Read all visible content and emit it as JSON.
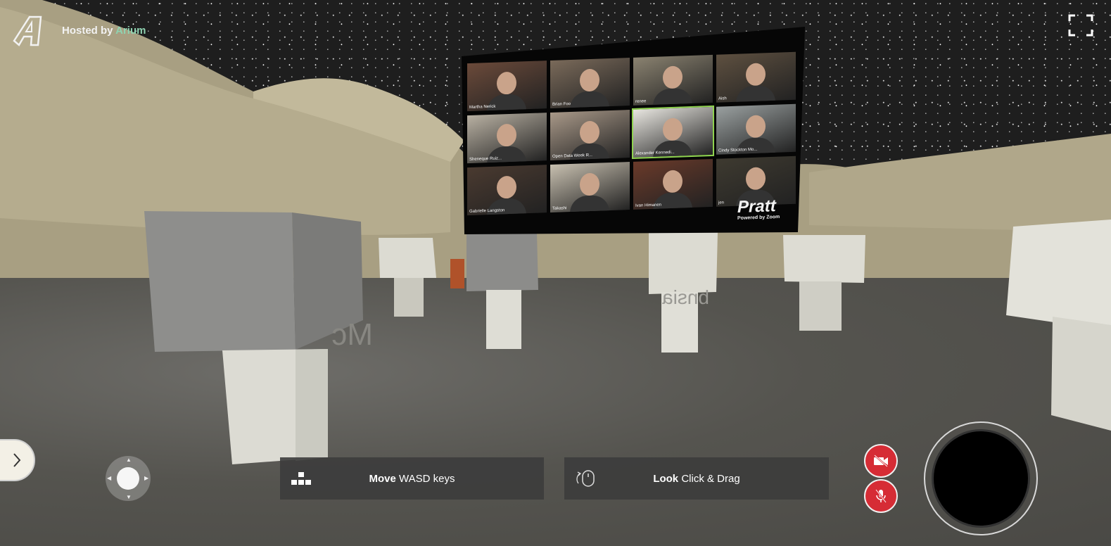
{
  "header": {
    "logo_icon": "arium-logo-icon",
    "hosted_prefix": "Hosted by",
    "host_name": "Arium",
    "brand_color": "#8fd3b1"
  },
  "fullscreen": {
    "icon": "fullscreen-icon"
  },
  "screen": {
    "participants": [
      "Martha Nerick",
      "Brian Foo",
      "renee",
      "Aish",
      "Sheneque Ruiz...",
      "Open Data Week R...",
      "Alexander Kennedi...",
      "Cindy Stockton Mo...",
      "Gabrielle Langston",
      "Takashi",
      "Ivan Himanen",
      "jen"
    ],
    "sponsor": "Pratt",
    "powered_by": "Powered by Zoom"
  },
  "controls": {
    "move": {
      "icon": "keyboard-keys-icon",
      "action": "Move",
      "keys": "WASD keys"
    },
    "look": {
      "icon": "mouse-drag-icon",
      "action": "Look",
      "keys": "Click & Drag"
    },
    "drawer_icon": "chevron-right-icon",
    "joystick_icon": "joystick-icon",
    "camera_icon": "camera-off-icon",
    "mic_icon": "mic-off-icon",
    "danger_color": "#d62c35"
  }
}
